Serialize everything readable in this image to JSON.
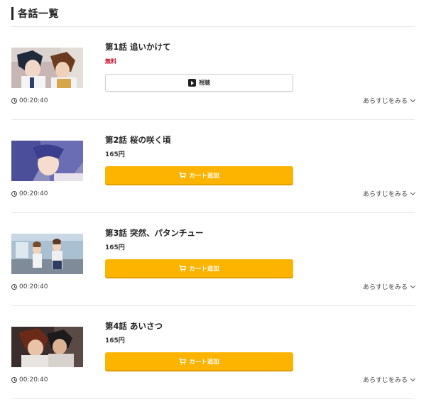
{
  "section": {
    "title": "各話一覧"
  },
  "episodes": [
    {
      "title": "第1話 追いかけて",
      "price": "無料",
      "button": "視聴",
      "duration": "00:20:40",
      "synopsis": "あらすじをみる"
    },
    {
      "title": "第2話 桜の咲く頃",
      "price": "165円",
      "button": "カート追加",
      "duration": "00:20:40",
      "synopsis": "あらすじをみる"
    },
    {
      "title": "第3話 突然、パタンチュー",
      "price": "165円",
      "button": "カート追加",
      "duration": "00:20:40",
      "synopsis": "あらすじをみる"
    },
    {
      "title": "第4話 あいさつ",
      "price": "165円",
      "button": "カート追加",
      "duration": "00:20:40",
      "synopsis": "あらすじをみる"
    }
  ],
  "colors": {
    "cart_button": "#fcb400",
    "free_text": "#c8102e"
  },
  "icons": {
    "play": "play-icon",
    "cart": "cart-icon",
    "clock": "clock-icon",
    "chevron": "chevron-down-icon"
  }
}
